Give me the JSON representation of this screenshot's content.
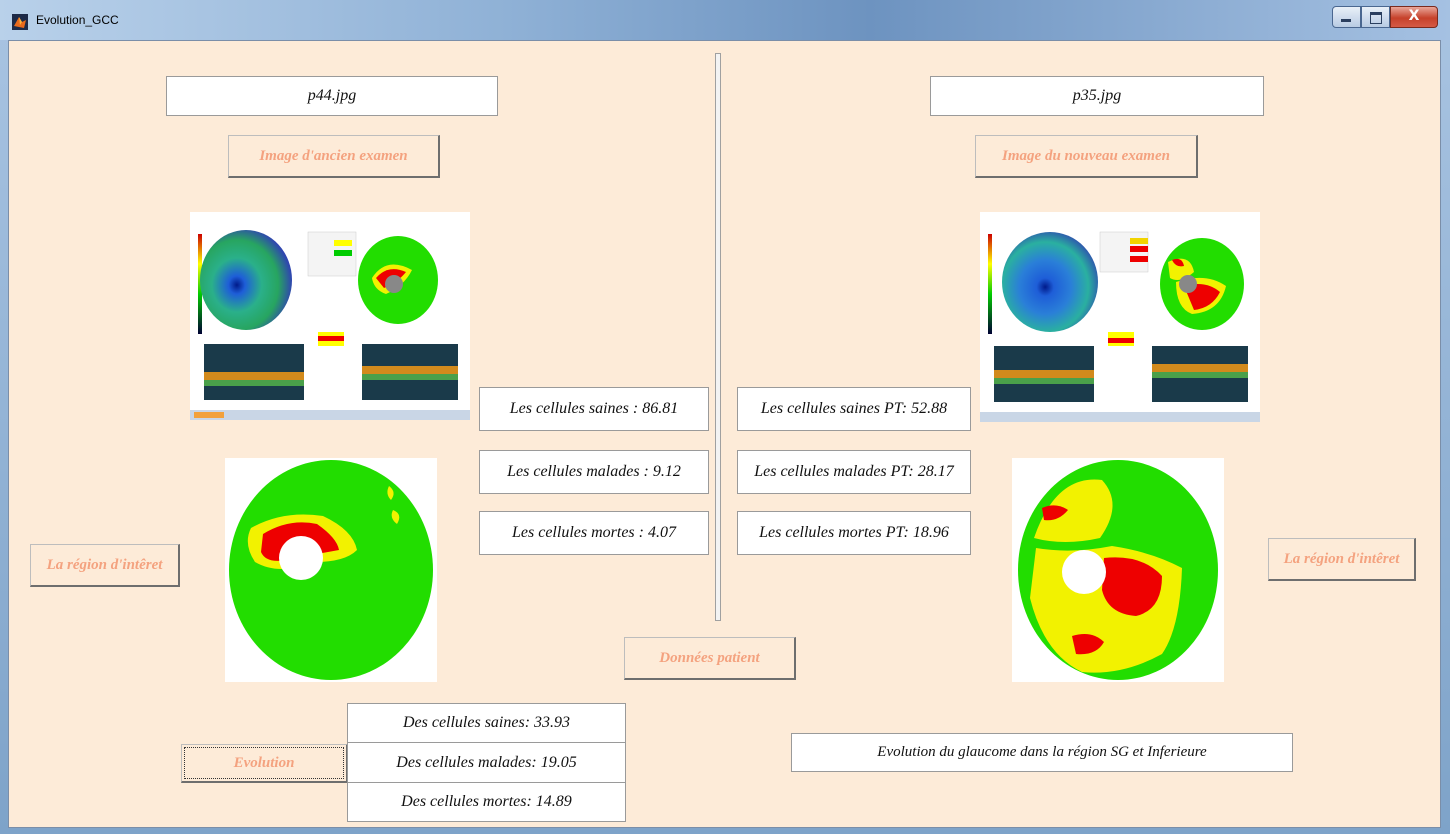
{
  "window": {
    "title": "Evolution_GCC",
    "close_glyph": "X"
  },
  "left": {
    "filename": "p44.jpg",
    "exam_label": "Image d'ancien examen",
    "roi_label": "La région d'intêret",
    "stats": {
      "saines": "Les cellules saines : 86.81",
      "malades": "Les cellules malades : 9.12",
      "mortes": "Les cellules mortes : 4.07"
    }
  },
  "right": {
    "filename": "p35.jpg",
    "exam_label": "Image du nouveau examen",
    "roi_label": "La région d'intêret",
    "stats": {
      "saines": "Les cellules saines PT: 52.88",
      "malades": "Les cellules malades PT: 28.17",
      "mortes": "Les cellules mortes PT: 18.96"
    }
  },
  "patient_button": "Données patient",
  "evolution": {
    "button": "Evolution",
    "saines": "Des cellules saines: 33.93",
    "malades": "Des cellules malades: 19.05",
    "mortes": "Des cellules mortes: 14.89",
    "summary": "Evolution du glaucome dans la région SG et Inferieure"
  },
  "colors": {
    "healthy": "#22dd00",
    "sick": "#f2f200",
    "dead": "#ee0000",
    "label_accent": "#f4a27f",
    "panel_bg": "#fdebd8"
  }
}
